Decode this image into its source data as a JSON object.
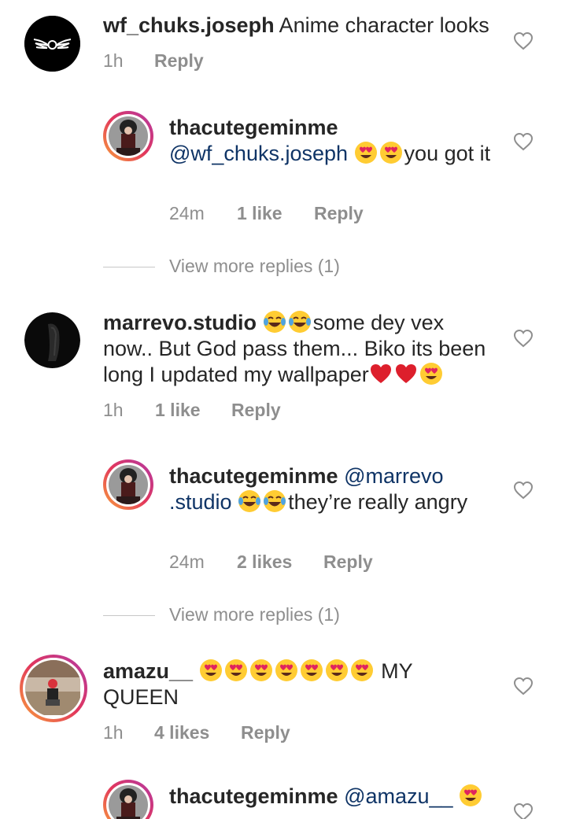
{
  "comments": [
    {
      "username": "wf_chuks.joseph",
      "text": "Anime character looks",
      "time": "1h",
      "reply": "Reply"
    },
    {
      "username": "thacutegeminme",
      "mention": "@wf_chuks.joseph",
      "emojis": [
        "heart-eyes",
        "heart-eyes"
      ],
      "text_after": "you got it",
      "time": "24m",
      "likes": "1 like",
      "reply": "Reply"
    },
    {
      "username": "marrevo.studio",
      "emojis_before": [
        "tears-of-joy",
        "tears-of-joy"
      ],
      "text": "some dey vex now.. But God pass them... Biko its been long I updated my wallpaper",
      "emojis_after": [
        "red-heart",
        "red-heart",
        "heart-eyes"
      ],
      "time": "1h",
      "likes": "1 like",
      "reply": "Reply"
    },
    {
      "username": "thacutegeminme",
      "mention": "@marrevo .studio",
      "emojis": [
        "tears-of-joy",
        "tears-of-joy"
      ],
      "text_after": "they’re really angry",
      "time": "24m",
      "likes": "2 likes",
      "reply": "Reply"
    },
    {
      "username": "amazu__",
      "emojis": [
        "heart-eyes",
        "heart-eyes",
        "heart-eyes",
        "heart-eyes",
        "heart-eyes",
        "heart-eyes",
        "heart-eyes"
      ],
      "text_after": "MY QUEEN",
      "time": "1h",
      "likes": "4 likes",
      "reply": "Reply"
    },
    {
      "username": "thacutegeminme",
      "mention": "@amazu__",
      "emojis": [
        "heart-eyes"
      ]
    }
  ],
  "view_more": [
    "View more replies (1)",
    "View more replies (1)"
  ],
  "icons": {
    "like": "heart-outline-icon"
  },
  "colors": {
    "text": "#262626",
    "meta": "#8e8e8e",
    "mention": "#0f3466",
    "story_ring": [
      "#f9a23a",
      "#e2365c",
      "#b23aa6"
    ]
  }
}
